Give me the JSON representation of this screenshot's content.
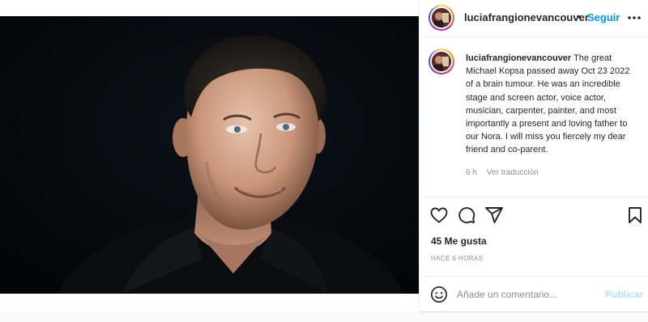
{
  "post": {
    "username": "luciafrangionevancouver",
    "separator": "•",
    "follow_label": "Seguir",
    "caption": {
      "username": "luciafrangionevancouver",
      "text": "The great Michael Kopsa passed away Oct 23 2022 of a brain tumour. He was an incredible stage and screen actor, voice actor, musician, carpenter, painter, and most importantly a present and loving father to our Nora. I will miss you fiercely my dear friend and co-parent.",
      "time_ago": "6 h",
      "translate_label": "Ver traducción"
    },
    "likes_label": "45 Me gusta",
    "posted_label": "HACE 6 HORAS",
    "comment": {
      "placeholder": "Añade un comentario...",
      "publish_label": "Publicar"
    }
  },
  "icons": {
    "header_avatar": "avatar-icon",
    "more": "more-options-icon",
    "like": "heart-icon",
    "comment": "comment-bubble-icon",
    "share": "paper-plane-icon",
    "save": "bookmark-icon",
    "emoji": "smiley-icon"
  },
  "colors": {
    "link_blue": "#0095f6",
    "publish_disabled": "#b2dffc",
    "muted": "#8e8e8e",
    "text": "#262626"
  }
}
